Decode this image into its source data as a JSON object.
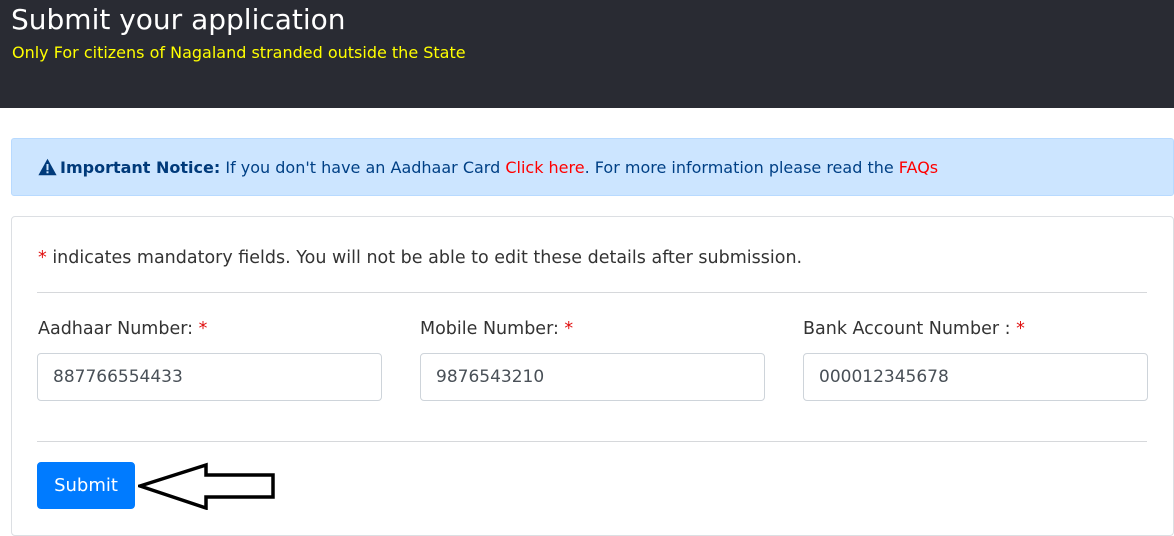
{
  "header": {
    "title": "Submit your application",
    "subtitle": "Only For citizens of Nagaland stranded outside the State"
  },
  "notice": {
    "icon": "warning-icon",
    "strong": "Important Notice:",
    "text1": " If you don't have an Aadhaar Card ",
    "link1": "Click here",
    "text2": ". For more information please read the ",
    "link2": "FAQs"
  },
  "form": {
    "mandatory_marker": "*",
    "mandatory_text": " indicates mandatory fields. You will not be able to edit these details after submission.",
    "fields": [
      {
        "label": "Aadhaar Number: ",
        "required": "*",
        "value": "887766554433"
      },
      {
        "label": "Mobile Number: ",
        "required": "*",
        "value": "9876543210"
      },
      {
        "label": "Bank Account Number : ",
        "required": "*",
        "value": "000012345678"
      }
    ],
    "submit_label": "Submit"
  },
  "colors": {
    "header_bg": "#292b33",
    "subtitle": "#ffff00",
    "notice_bg": "#cce5ff",
    "link": "#ff0000",
    "primary": "#007bff"
  }
}
